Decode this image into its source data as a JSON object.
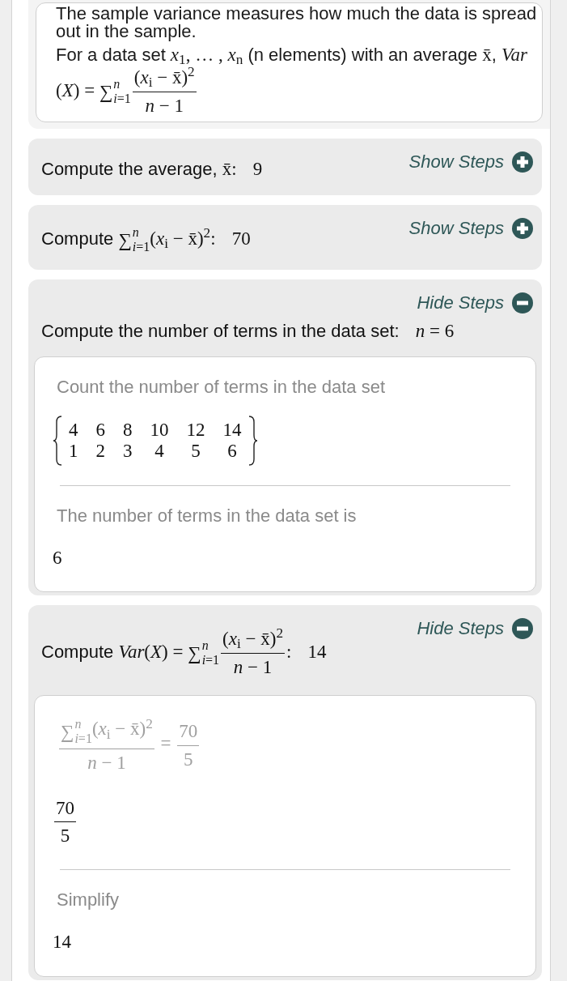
{
  "intro": {
    "paragraphs": [
      [
        {
          "kind": "text",
          "text": "The sample variance measures how much the data is spread out in the sample."
        }
      ],
      [
        {
          "kind": "text",
          "text": "For a data set "
        },
        {
          "kind": "math",
          "text": "*x*$_{1}$, … , *x*$_{n}$"
        },
        {
          "kind": "text",
          "text": " (n elements) with an average "
        },
        {
          "kind": "math",
          "text": "x̄"
        },
        {
          "kind": "text",
          "text": ", "
        },
        {
          "kind": "var",
          "text": "Var"
        },
        {
          "kind": "math",
          "text": "(*X*) = "
        },
        {
          "kind": "sum",
          "symbol": "∑",
          "sup": "*n*",
          "sub": "*i*=1"
        },
        {
          "kind": "frac",
          "num": [
            {
              "kind": "math",
              "text": "(*x*$_{i}$ − x̄)$^{2}$"
            }
          ],
          "den": [
            {
              "kind": "math",
              "text": "*n* − 1"
            }
          ]
        }
      ]
    ]
  },
  "steps": [
    {
      "title": [
        {
          "kind": "text",
          "text": "Compute the average, "
        },
        {
          "kind": "math",
          "text": "x̄:"
        }
      ],
      "result": [
        {
          "kind": "math",
          "text": "9"
        }
      ],
      "toggle": {
        "label": "Show Steps",
        "expanded": false
      }
    },
    {
      "title": [
        {
          "kind": "text",
          "text": "Compute "
        },
        {
          "kind": "sum",
          "symbol": "∑",
          "sup": "*n*",
          "sub": "*i*=1"
        },
        {
          "kind": "math",
          "text": "(*x*$_{i}$ − x̄)$^{2}$:"
        }
      ],
      "result": [
        {
          "kind": "math",
          "text": "70"
        }
      ],
      "toggle": {
        "label": "Show Steps",
        "expanded": false
      }
    },
    {
      "title": [
        {
          "kind": "text",
          "text": "Compute the number of terms in the data set:"
        }
      ],
      "result": [
        {
          "kind": "math",
          "text": "*n* = 6"
        }
      ],
      "toggle": {
        "label": "Hide Steps",
        "expanded": true
      },
      "substeps": [
        {
          "items": [
            {
              "kind": "explanation",
              "text": "Count the number of terms in the data set"
            },
            {
              "kind": "table",
              "rows": [
                [
                  "4",
                  "6",
                  "8",
                  "10",
                  "12",
                  "14"
                ],
                [
                  "1",
                  "2",
                  "3",
                  "4",
                  "5",
                  "6"
                ]
              ]
            }
          ]
        },
        {
          "items": [
            {
              "kind": "explanation",
              "text": "The number of terms in the data set is"
            },
            {
              "kind": "result",
              "math": [
                {
                  "kind": "math",
                  "text": "6"
                }
              ]
            }
          ]
        }
      ]
    },
    {
      "title": [
        {
          "kind": "text",
          "text": "Compute "
        },
        {
          "kind": "math",
          "text": "*Var*(*X*) = "
        },
        {
          "kind": "sum",
          "symbol": "∑",
          "sup": "*n*",
          "sub": "*i*=1"
        },
        {
          "kind": "frac",
          "num": [
            {
              "kind": "math",
              "text": "(*x*$_{i}$ − x̄)$^{2}$"
            }
          ],
          "den": [
            {
              "kind": "math",
              "text": "*n* − 1"
            }
          ]
        },
        {
          "kind": "math",
          "text": ":"
        }
      ],
      "result": [
        {
          "kind": "math",
          "text": "14"
        }
      ],
      "toggle": {
        "label": "Hide Steps",
        "expanded": true
      },
      "substeps": [
        {
          "items": [
            {
              "kind": "work",
              "math": [
                {
                  "kind": "frac",
                  "num": [
                    {
                      "kind": "sum",
                      "symbol": "∑",
                      "sup": "*n*",
                      "sub": "*i*=1"
                    },
                    {
                      "kind": "math",
                      "text": "(*x*$_{i}$ − x̄)$^{2}$"
                    }
                  ],
                  "den": [
                    {
                      "kind": "math",
                      "text": "*n* − 1"
                    }
                  ]
                },
                {
                  "kind": "math",
                  "text": " = "
                },
                {
                  "kind": "frac",
                  "num": [
                    {
                      "kind": "math",
                      "text": "70"
                    }
                  ],
                  "den": [
                    {
                      "kind": "math",
                      "text": "5"
                    }
                  ]
                }
              ]
            },
            {
              "kind": "result",
              "math": [
                {
                  "kind": "frac",
                  "num": [
                    {
                      "kind": "math",
                      "text": "70"
                    }
                  ],
                  "den": [
                    {
                      "kind": "math",
                      "text": "5"
                    }
                  ]
                }
              ]
            }
          ]
        },
        {
          "items": [
            {
              "kind": "explanation",
              "text": "Simplify"
            },
            {
              "kind": "result",
              "math": [
                {
                  "kind": "math",
                  "text": "14"
                }
              ]
            }
          ]
        }
      ]
    }
  ]
}
